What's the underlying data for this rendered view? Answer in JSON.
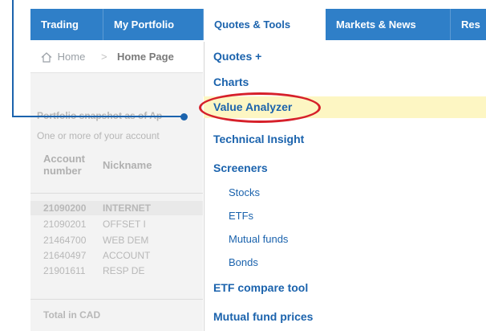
{
  "nav": {
    "tabs": [
      {
        "label": "Trading"
      },
      {
        "label": "My Portfolio"
      },
      {
        "label": "Quotes & Tools"
      },
      {
        "label": "Markets & News"
      },
      {
        "label": "Res"
      }
    ]
  },
  "breadcrumb": {
    "home": "Home",
    "separator": ">",
    "current": "Home Page"
  },
  "portfolio": {
    "snapshot": "Portfolio snapshot as of Ap",
    "note": "One or more of your account",
    "headers": {
      "account_line1": "Account",
      "account_line2": "number",
      "nickname": "Nickname"
    },
    "rows": [
      {
        "account": "21090200",
        "nickname": "INTERNET"
      },
      {
        "account": "21090201",
        "nickname": "OFFSET I"
      },
      {
        "account": "21464700",
        "nickname": "WEB DEM"
      },
      {
        "account": "21640497",
        "nickname": "ACCOUNT"
      },
      {
        "account": "21901611",
        "nickname": "RESP DE"
      }
    ],
    "total": "Total in CAD"
  },
  "menu": {
    "quotes_plus": "Quotes +",
    "charts": "Charts",
    "value_analyzer": "Value Analyzer",
    "technical_insight": "Technical Insight",
    "screeners": "Screeners",
    "stocks": "Stocks",
    "etfs": "ETFs",
    "mutual_funds": "Mutual funds",
    "bonds": "Bonds",
    "etf_compare": "ETF compare tool",
    "mutual_fund_prices": "Mutual fund prices"
  },
  "colors": {
    "nav": "#2f7fc8",
    "link": "#1b63ad",
    "highlight": "#fdf6c3",
    "annotation": "#d6202a"
  }
}
